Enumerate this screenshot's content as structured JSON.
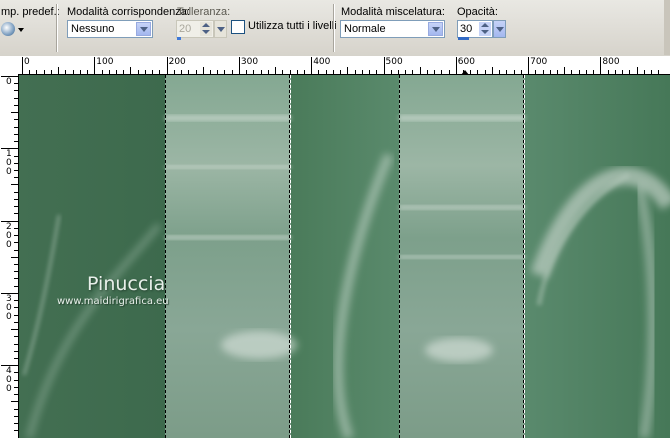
{
  "toolbar": {
    "preset_label": "mp. predef.:",
    "match_mode_label": "Modalità corrispondenza:",
    "match_mode_value": "Nessuno",
    "tolerance_label": "Tolleranza:",
    "tolerance_value": "20",
    "use_all_layers_label": "Utilizza tutti i livelli",
    "use_all_layers_checked": false,
    "blend_mode_label": "Modalità miscelatura:",
    "blend_mode_value": "Normale",
    "opacity_label": "Opacità:",
    "opacity_value": "30"
  },
  "ruler": {
    "horizontal_labels": [
      "0",
      "100",
      "200",
      "300",
      "400",
      "500",
      "600",
      "700",
      "800"
    ],
    "vertical_labels": [
      "0",
      "100",
      "200",
      "300",
      "400"
    ]
  },
  "canvas": {
    "background_color": "#4b7d5c",
    "watermark_name": "Pinuccia",
    "watermark_url": "www.maidirigrafica.eu"
  },
  "colors": {
    "accent": "#316ac5",
    "canvas_green": "#4b7d5c"
  }
}
